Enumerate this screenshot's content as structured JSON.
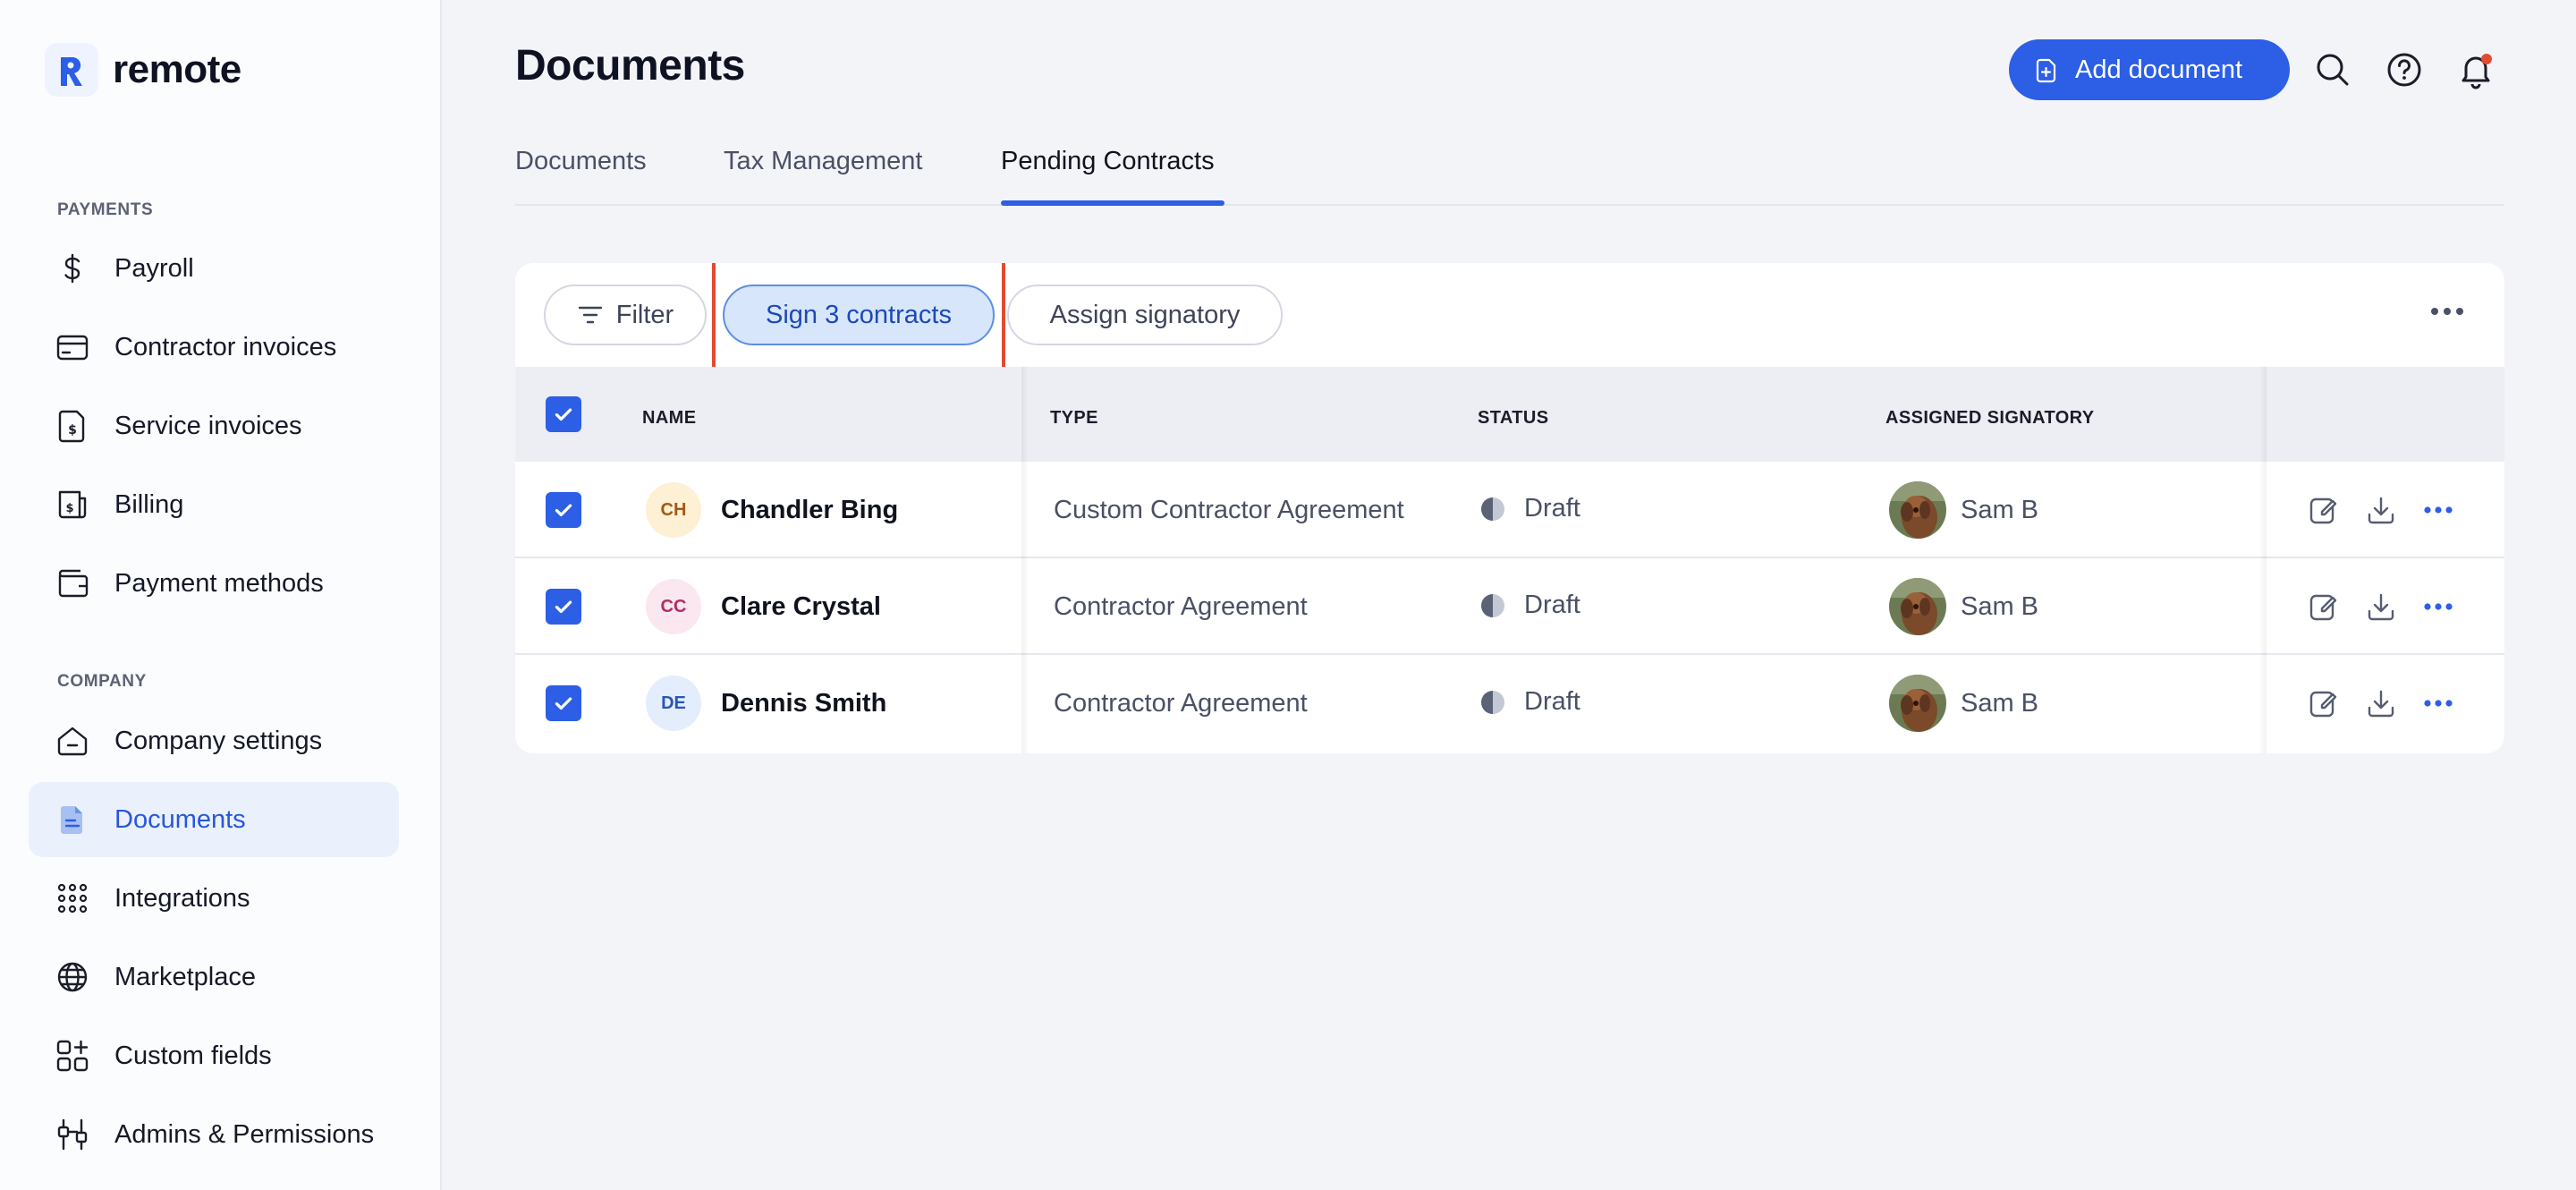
{
  "brand": {
    "name": "remote",
    "accent": "#2c5ee6"
  },
  "sidebar": {
    "sections": [
      {
        "label": "PAYMENTS"
      },
      {
        "label": "COMPANY"
      }
    ],
    "items": [
      {
        "label": "Payroll",
        "icon": "dollar-icon"
      },
      {
        "label": "Contractor invoices",
        "icon": "card-icon"
      },
      {
        "label": "Service invoices",
        "icon": "invoice-icon"
      },
      {
        "label": "Billing",
        "icon": "billing-icon"
      },
      {
        "label": "Payment methods",
        "icon": "wallet-icon"
      },
      {
        "label": "Company settings",
        "icon": "home-icon"
      },
      {
        "label": "Documents",
        "icon": "document-icon",
        "active": true
      },
      {
        "label": "Integrations",
        "icon": "grid-icon"
      },
      {
        "label": "Marketplace",
        "icon": "globe-icon"
      },
      {
        "label": "Custom fields",
        "icon": "custom-fields-icon"
      },
      {
        "label": "Admins & Permissions",
        "icon": "sliders-icon"
      }
    ]
  },
  "header": {
    "title": "Documents",
    "add_button": "Add document"
  },
  "tabs": [
    {
      "label": "Documents"
    },
    {
      "label": "Tax Management"
    },
    {
      "label": "Pending Contracts",
      "active": true
    }
  ],
  "toolbar": {
    "filter": "Filter",
    "sign": "Sign 3 contracts",
    "assign": "Assign signatory"
  },
  "table": {
    "columns": [
      "NAME",
      "TYPE",
      "STATUS",
      "ASSIGNED SIGNATORY"
    ],
    "rows": [
      {
        "initials": "CH",
        "name": "Chandler Bing",
        "type": "Custom Contractor Agreement",
        "status": "Draft",
        "signatory": "Sam B",
        "checked": true
      },
      {
        "initials": "CC",
        "name": "Clare Crystal",
        "type": "Contractor Agreement",
        "status": "Draft",
        "signatory": "Sam B",
        "checked": true
      },
      {
        "initials": "DE",
        "name": "Dennis Smith",
        "type": "Contractor Agreement",
        "status": "Draft",
        "signatory": "Sam B",
        "checked": true
      }
    ]
  }
}
